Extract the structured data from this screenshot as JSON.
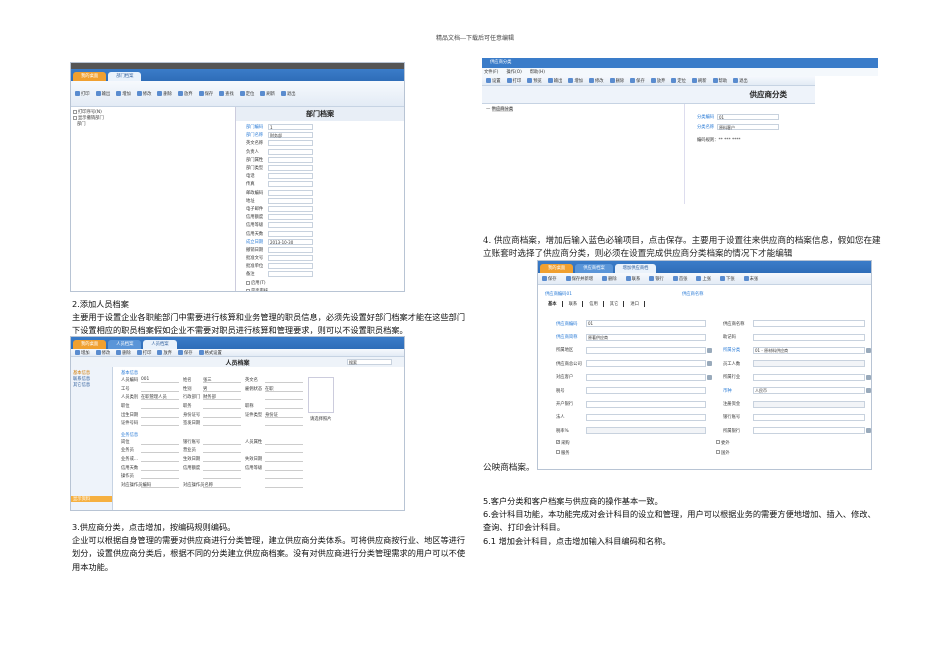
{
  "header": "精品文档---下载后可任意编辑",
  "dept": {
    "tabs": [
      "我的桌面",
      "部门档案"
    ],
    "toolbar": [
      "打印",
      "输出",
      "增加",
      "修改",
      "删除",
      "放弃",
      "保存",
      "查找",
      "定位",
      "刷新",
      "退出"
    ],
    "options": [
      "打印序号(N)",
      "显示撤销部门"
    ],
    "tree_root": "部门",
    "title": "部门档案",
    "fields": [
      {
        "label": "部门编码",
        "value": "1",
        "req": true
      },
      {
        "label": "部门名称",
        "value": "财务部",
        "req": true
      },
      {
        "label": "英文名称",
        "value": ""
      },
      {
        "label": "负责人",
        "value": ""
      },
      {
        "label": "部门属性",
        "value": ""
      },
      {
        "label": "部门类型",
        "value": ""
      },
      {
        "label": "电话",
        "value": ""
      },
      {
        "label": "传真",
        "value": ""
      },
      {
        "label": "邮政编码",
        "value": ""
      },
      {
        "label": "地址",
        "value": ""
      },
      {
        "label": "电子邮件",
        "value": ""
      },
      {
        "label": "信用额度",
        "value": ""
      },
      {
        "label": "信用等级",
        "value": ""
      },
      {
        "label": "信用天数",
        "value": ""
      },
      {
        "label": "成立日期",
        "value": "2013-10-30",
        "req": true
      },
      {
        "label": "撤销日期",
        "value": ""
      },
      {
        "label": "批准文号",
        "value": ""
      },
      {
        "label": "批准单位",
        "value": ""
      },
      {
        "label": "备注",
        "value": ""
      }
    ],
    "checks": [
      "启用(T)",
      "是否审核"
    ],
    "rule_label": "编码规则：",
    "rule": "* **"
  },
  "section2": {
    "heading": "2.添加人员档案",
    "body": "主要用于设置企业各职能部门中需要进行核算和业务管理的职员信息，必须先设置好部门档案才能在这些部门下设置相应的职员档案假如企业不需要对职员进行核算和管理要求，则可以不设置职员档案。"
  },
  "person": {
    "tabs": [
      "我的桌面",
      "人员档案",
      "人员档案"
    ],
    "toolbar": [
      "增加",
      "修改",
      "删除",
      "打印",
      "放弃",
      "保存",
      "格式设置"
    ],
    "title": "人员档案",
    "search_placeholder": "搜索",
    "side": [
      "基本信息",
      "联系信息",
      "其它信息"
    ],
    "side_footer": "显示资料",
    "group1": "基本信息",
    "group2": "业务信息",
    "fields": [
      [
        "人员编码",
        "001",
        "姓名",
        "张三",
        "英文名",
        ""
      ],
      [
        "工号",
        "",
        "性别",
        "男",
        "雇佣状态",
        "在职"
      ],
      [
        "人员类别",
        "在职管理人员",
        "行政部门",
        "财务部",
        "",
        ""
      ],
      [
        "职位",
        "",
        "职务",
        "",
        "职称",
        ""
      ],
      [
        "出生日期",
        "",
        "身份证号",
        "",
        "证件类型",
        "身份证"
      ],
      [
        "证件号码",
        "",
        "签发日期",
        "",
        "",
        ""
      ]
    ],
    "photo": "请选择照片",
    "fields2": [
      [
        "岗位",
        "",
        "银行账号",
        "",
        "人员属性",
        ""
      ],
      [
        "业务员",
        "",
        "营业员",
        "",
        "",
        ""
      ],
      [
        "业务或...",
        "",
        "生效日期",
        "",
        "失效日期",
        ""
      ],
      [
        "信用天数",
        "",
        "信用额度",
        "",
        "信用等级",
        ""
      ],
      [
        "操作员",
        "",
        "",
        "",
        "",
        ""
      ],
      [
        "对应操作员编码",
        "",
        "对应操作员名称",
        "",
        "",
        ""
      ]
    ]
  },
  "section3": {
    "heading": "3.供应商分类，点击增加，按编码规则编码。",
    "body": "企业可以根据自身管理的需要对供应商进行分类管理，建立供应商分类体系。可将供应商按行业、地区等进行划分，设置供应商分类后，根据不同的分类建立供应商档案。没有对供应商进行分类管理需求的用户可以不使用本功能。"
  },
  "supcls": {
    "window_title": "供应商分类",
    "menu": [
      "文件(F)",
      "操作(O)",
      "帮助(H)"
    ],
    "toolbar": [
      "设置",
      "打印",
      "预览",
      "输出",
      "增加",
      "修改",
      "删除",
      "保存",
      "放弃",
      "定位",
      "刷新",
      "帮助",
      "退出"
    ],
    "title": "供应商分类",
    "tree_root": "供应商分类",
    "fields": [
      {
        "label": "分类编码",
        "value": "01"
      },
      {
        "label": "分类名称",
        "value": "原料客户"
      }
    ],
    "rule_label": "编码规则：",
    "rule": "** *** ****"
  },
  "section4": {
    "body": "4. 供应商档案，增加后输入蓝色必输项目，点击保存。主要用于设置往来供应商的档案信息，假如您在建立账套时选择了供应商分类，则必须在设置完成供应商分类档案的情况下才能编辑",
    "tail": "公映商档案。"
  },
  "supplier": {
    "tabs": [
      "我的桌面",
      "供应商档案",
      "增加供应商档"
    ],
    "toolbar": [
      "保存",
      "保存并新增",
      "删除",
      "联系",
      "银行",
      "首张",
      "上张",
      "下张",
      "末张"
    ],
    "code_line": "供应商编码01",
    "name_line": "供应商名称",
    "subtabs": [
      "基本",
      "联系",
      "信用",
      "其它",
      "进口"
    ],
    "left": [
      {
        "label": "供应商编码",
        "value": "01",
        "req": true
      },
      {
        "label": "供应商简称",
        "value": "原著供应商",
        "req": true
      },
      {
        "label": "所属地区",
        "value": "",
        "ref": true
      },
      {
        "label": "供应商总公司",
        "value": "",
        "ref": true
      },
      {
        "label": "对应客户",
        "value": "",
        "ref": true
      },
      {
        "label": "税号",
        "value": ""
      },
      {
        "label": "开户银行",
        "value": ""
      },
      {
        "label": "法人",
        "value": ""
      },
      {
        "label": "税率%",
        "value": "",
        "ro": true
      }
    ],
    "right": [
      {
        "label": "供应商名称",
        "value": ""
      },
      {
        "label": "助记码",
        "value": ""
      },
      {
        "label": "所属分类",
        "value": "01 - 原材料供应商",
        "req": true,
        "ref": true
      },
      {
        "label": "员工人数",
        "value": "",
        "ro": true
      },
      {
        "label": "所属行业",
        "value": "",
        "ref": true
      },
      {
        "label": "币种",
        "value": "人民币",
        "req": true,
        "ref": true
      },
      {
        "label": "注册资金",
        "value": "",
        "ro": true
      },
      {
        "label": "银行账号",
        "value": ""
      },
      {
        "label": "所属银行",
        "value": "",
        "ref": true
      }
    ],
    "checks": [
      {
        "label": "采购",
        "checked": true
      },
      {
        "label": "委外",
        "checked": false
      },
      {
        "label": "服务",
        "checked": false
      },
      {
        "label": "国外",
        "checked": false
      }
    ]
  },
  "section5": {
    "lines": [
      "5.客户分类和客户档案与供应商的操作基本一致。",
      "6.会计科目功能，本功能完成对会计科目的设立和管理，用户可以根据业务的需要方便地增加、插入、修改、查询、打印会计科目。",
      "6.1 增加会计科目，点击增加输入科目编码和名称。"
    ]
  }
}
